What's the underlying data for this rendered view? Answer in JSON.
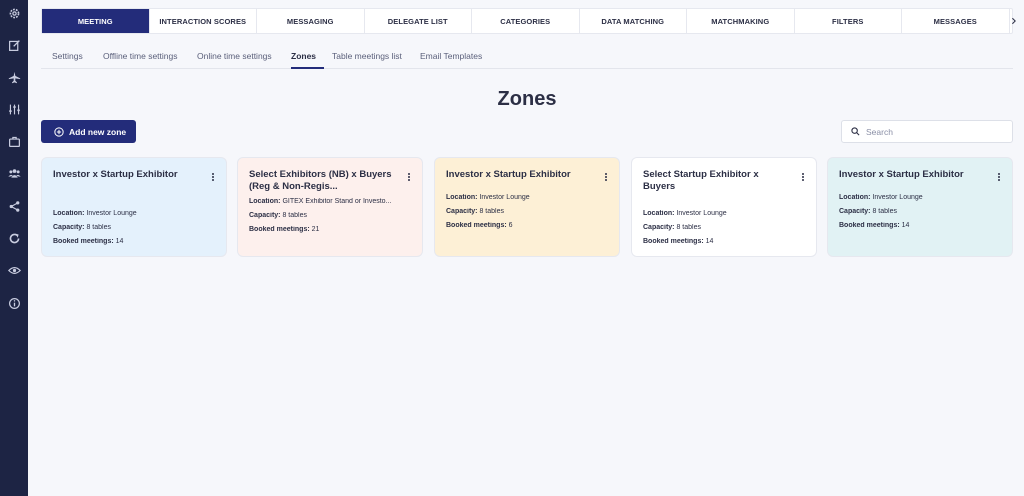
{
  "sidebar": {
    "icons": [
      "settings-icon",
      "edit-icon",
      "plane-icon",
      "sliders-icon",
      "briefcase-icon",
      "users-icon",
      "share-icon",
      "refresh-icon",
      "eye-icon",
      "info-icon"
    ]
  },
  "tabs": [
    {
      "label": "MEETING",
      "active": true
    },
    {
      "label": "INTERACTION SCORES",
      "active": false
    },
    {
      "label": "MESSAGING",
      "active": false
    },
    {
      "label": "DELEGATE LIST",
      "active": false
    },
    {
      "label": "CATEGORIES",
      "active": false
    },
    {
      "label": "DATA MATCHING",
      "active": false
    },
    {
      "label": "MATCHMAKING",
      "active": false
    },
    {
      "label": "FILTERS",
      "active": false
    },
    {
      "label": "MESSAGES",
      "active": false
    }
  ],
  "subtabs": [
    {
      "label": "Settings",
      "active": false
    },
    {
      "label": "Offline time settings",
      "active": false
    },
    {
      "label": "Online time settings",
      "active": false
    },
    {
      "label": "Zones",
      "active": true
    },
    {
      "label": "Table meetings list",
      "active": false
    },
    {
      "label": "Email Templates",
      "active": false
    }
  ],
  "page": {
    "title": "Zones"
  },
  "actions": {
    "add_label": "Add new zone",
    "search_placeholder": "Search"
  },
  "labels": {
    "location": "Location:",
    "capacity": "Capacity:",
    "booked": "Booked meetings:"
  },
  "zones": [
    {
      "title": "Investor x Startup Exhibitor",
      "location": "Investor Lounge",
      "capacity": "8 tables",
      "booked": "14",
      "color": "#e4f1fc"
    },
    {
      "title": "Select Exhibitors (NB) x Buyers (Reg & Non-Regis...",
      "location": "GITEX Exhibitor Stand or Investo...",
      "capacity": "8 tables",
      "booked": "21",
      "color": "#fdf0ed"
    },
    {
      "title": "Investor x Startup Exhibitor",
      "location": "Investor Lounge",
      "capacity": "8 tables",
      "booked": "6",
      "color": "#fdf0d6"
    },
    {
      "title": "Select Startup Exhibitor x Buyers",
      "location": "Investor Lounge",
      "capacity": "8 tables",
      "booked": "14",
      "color": "#ffffff"
    },
    {
      "title": "Investor x Startup Exhibitor",
      "location": "Investor Lounge",
      "capacity": "8 tables",
      "booked": "14",
      "color": "#e1f2f4"
    }
  ],
  "colors": {
    "primary": "#232c7a",
    "sidebar": "#1d2444"
  }
}
